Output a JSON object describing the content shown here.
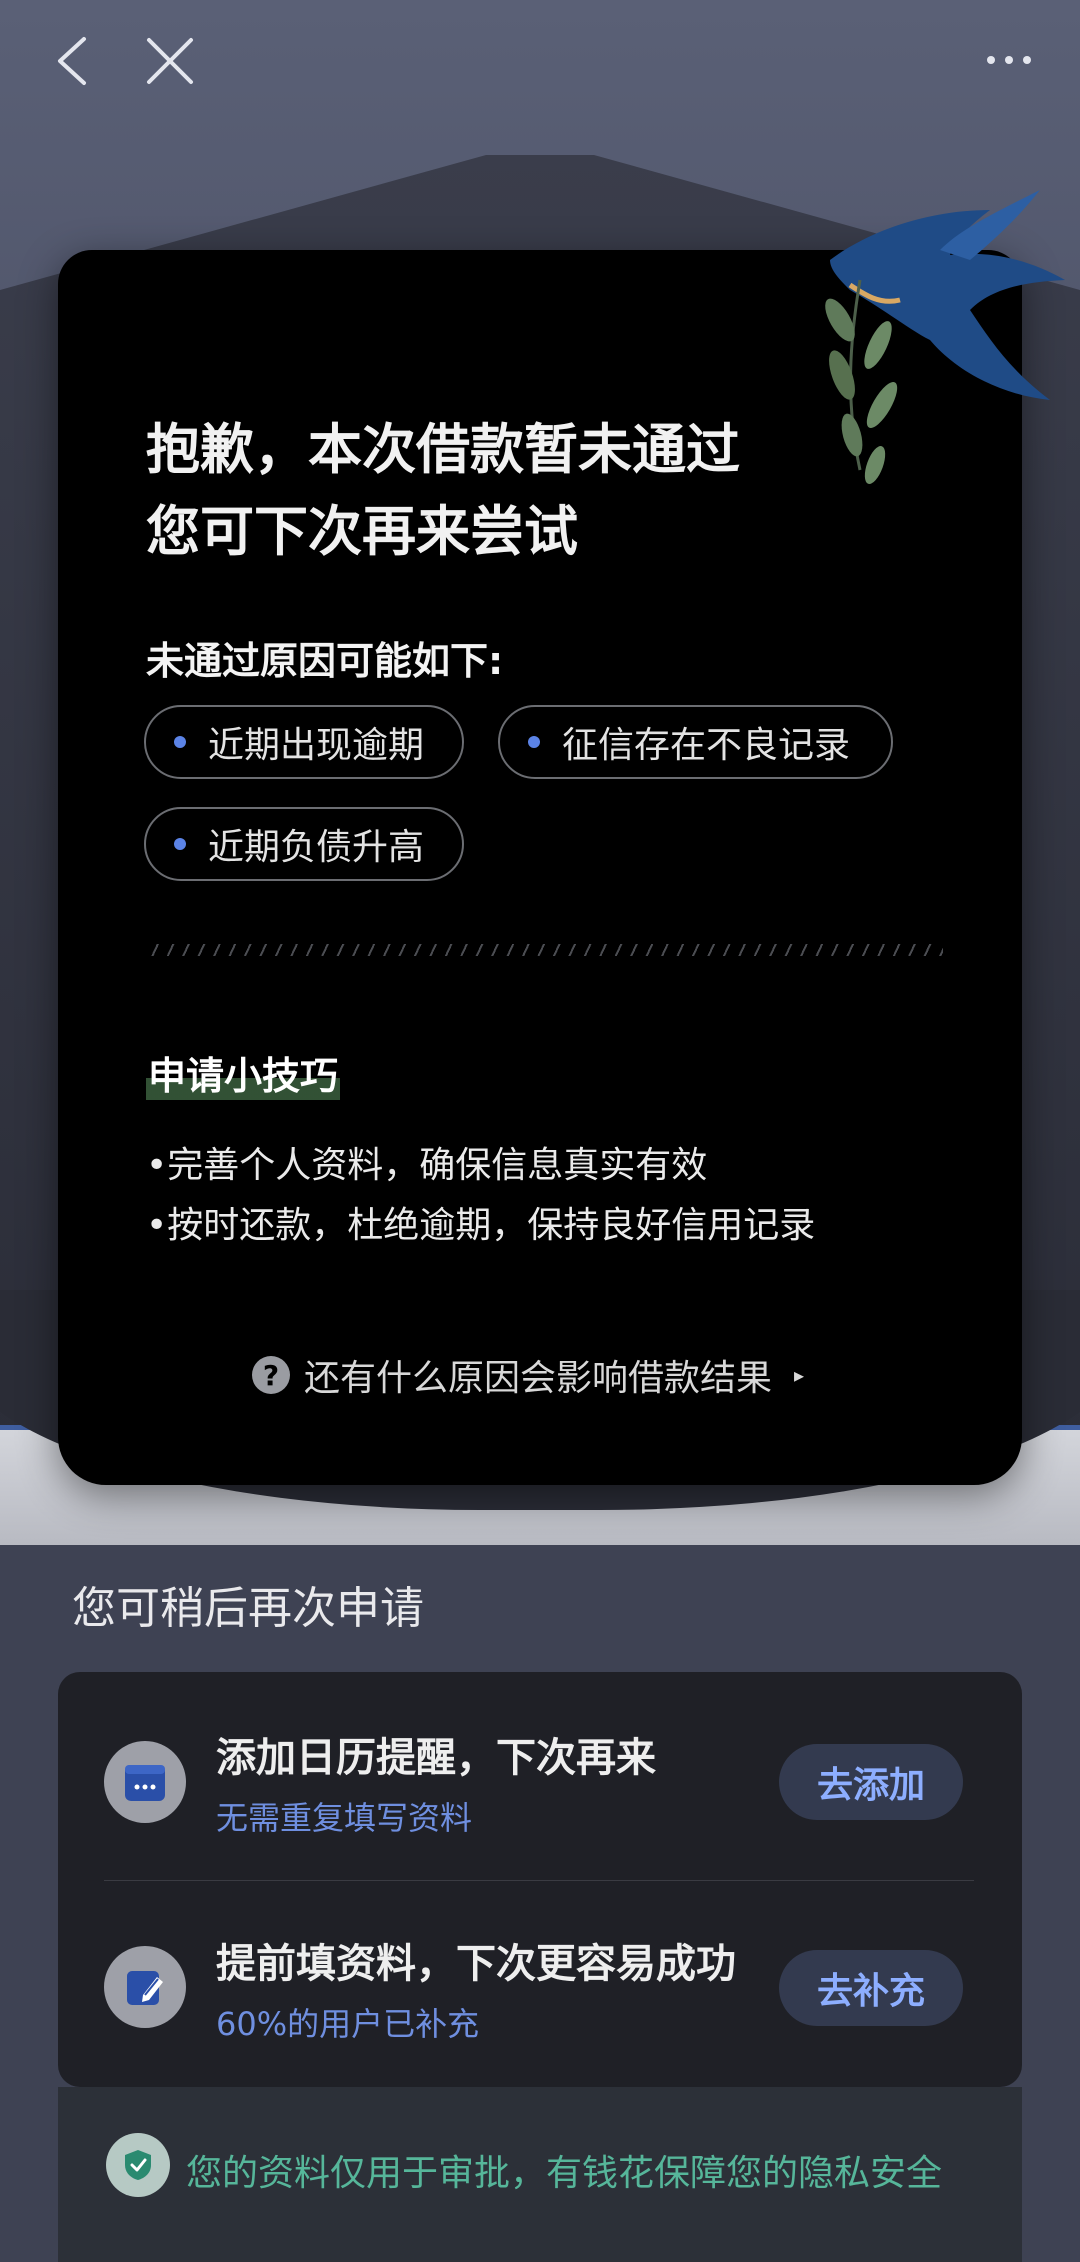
{
  "nav": {
    "back_icon": "chevron-left-icon",
    "close_icon": "close-icon",
    "more_icon": "more-horizontal-icon"
  },
  "card": {
    "title_line1": "抱歉，本次借款暂未通过",
    "title_line2": "您可下次再来尝试",
    "reasons_title": "未通过原因可能如下:",
    "reasons": [
      "近期出现逾期",
      "征信存在不良记录",
      "近期负债升高"
    ],
    "tips_title": "申请小技巧",
    "tips": [
      "•完善个人资料，确保信息真实有效",
      "•按时还款，杜绝逾期，保持良好信用记录"
    ],
    "more_reasons_icon_text": "?",
    "more_reasons_label": "还有什么原因会影响借款结果",
    "more_reasons_arrow": "▸"
  },
  "later": {
    "title": "您可稍后再次申请",
    "rows": [
      {
        "icon": "calendar-icon",
        "title": "添加日历提醒，下次再来",
        "subtitle": "无需重复填写资料",
        "button": "去添加"
      },
      {
        "icon": "edit-document-icon",
        "title": "提前填资料，下次更容易成功",
        "subtitle": "60%的用户已补充",
        "button": "去补充"
      }
    ]
  },
  "privacy": {
    "icon": "shield-check-icon",
    "text": "您的资料仅用于审批，有钱花保障您的隐私安全"
  },
  "colors": {
    "accent_blue": "#6f8fe0",
    "button_text": "#8daeff",
    "privacy_green": "#56b69a",
    "pill_dot": "#5b83e6"
  }
}
